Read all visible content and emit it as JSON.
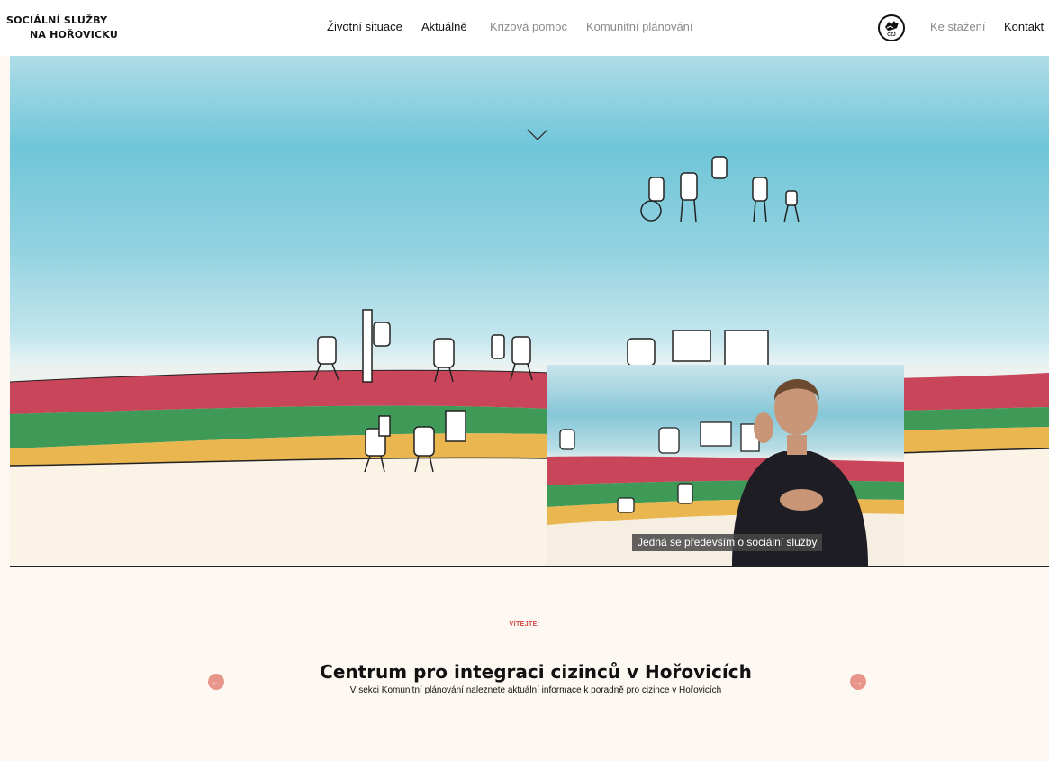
{
  "logo": {
    "line1": "SOCIÁLNÍ SLUŽBY",
    "line2": "NA HOŘOVICKU"
  },
  "nav": {
    "items": [
      {
        "label": "Životní situace",
        "dimmed": false
      },
      {
        "label": "Aktuálně",
        "dimmed": false
      },
      {
        "label": "Krizová pomoc",
        "dimmed": true
      },
      {
        "label": "Komunitní plánování",
        "dimmed": true
      }
    ],
    "sign_language_label": "ČZJ",
    "downloads": "Ke stažení",
    "contact": "Kontakt"
  },
  "hero": {
    "scroll_icon": "chevron-down-icon",
    "video_caption": "Jedná se především o sociální služby"
  },
  "welcome": {
    "label": "VÍTEJTE:",
    "title": "Centrum pro integraci cizinců v Hořovicích",
    "subtitle": "V sekci Komunitní plánování naleznete aktuální informace k poradně pro cizince v Hořovicích",
    "prev_icon": "arrow-left-circle-icon",
    "next_icon": "arrow-right-circle-icon"
  },
  "colors": {
    "accent": "#d4473f",
    "arrow": "#e8968c",
    "stripe_red": "#c8455a",
    "stripe_green": "#3f9a57",
    "stripe_yellow": "#e9b64f"
  }
}
